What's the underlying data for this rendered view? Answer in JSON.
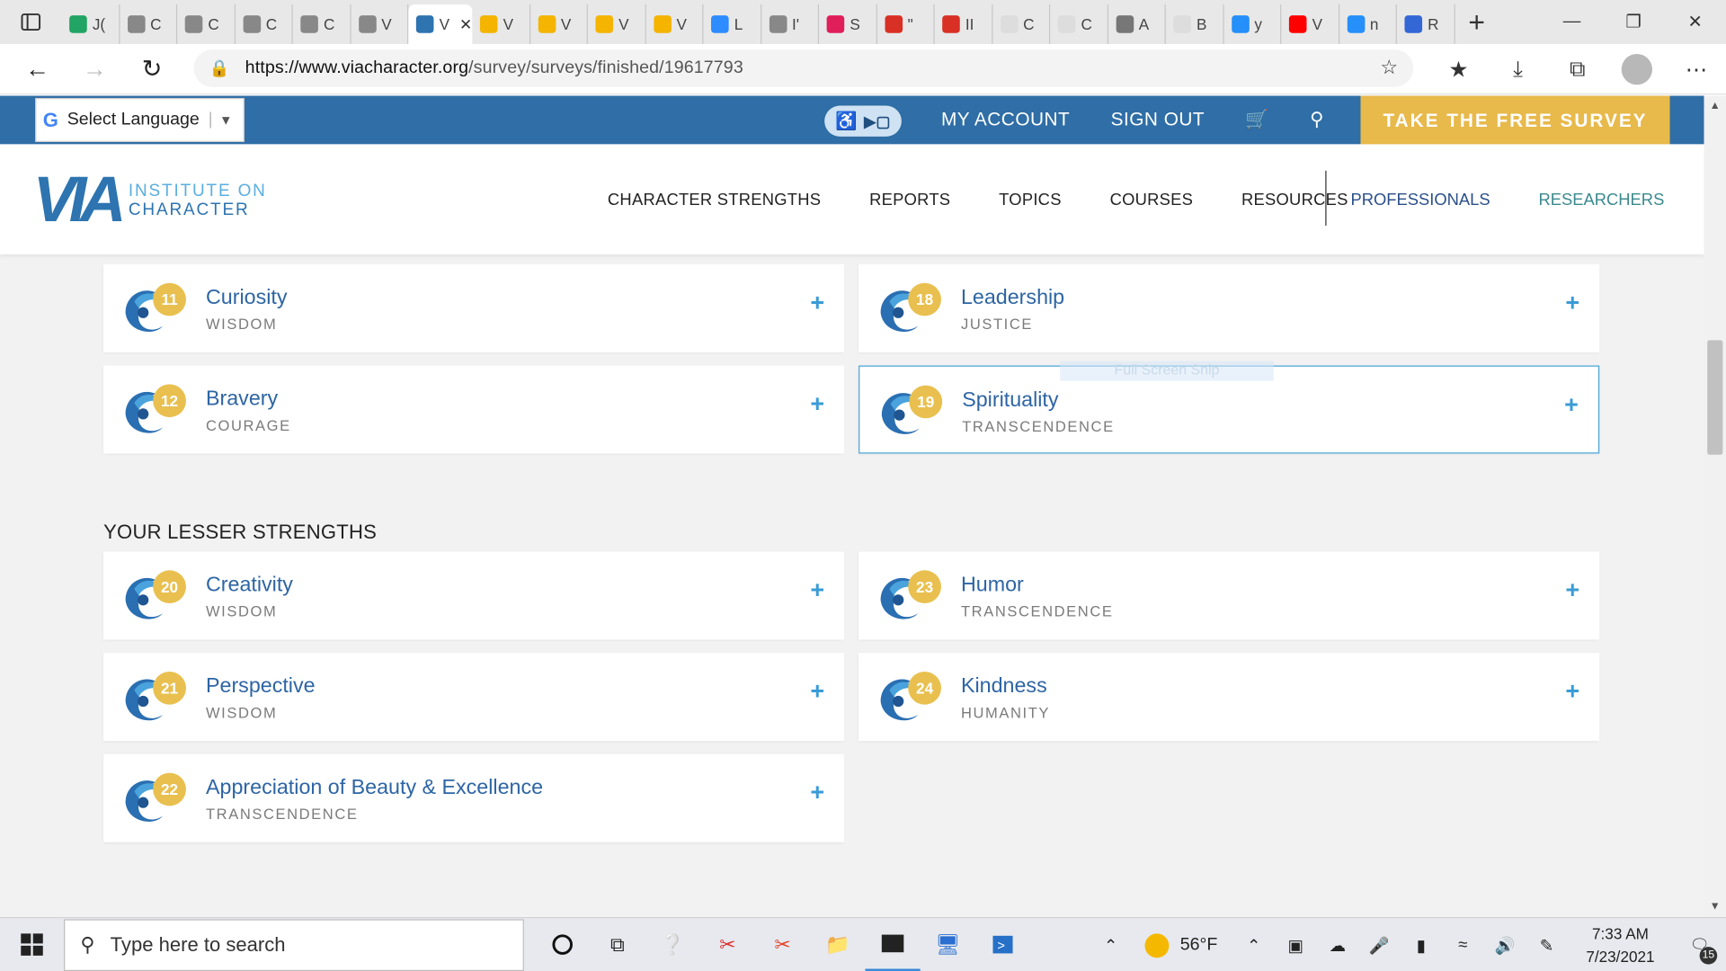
{
  "browser": {
    "tabs": [
      {
        "icon": "sheets-icon",
        "title": "J(",
        "color": "#21a464"
      },
      {
        "icon": "arrow-page-icon",
        "title": "C",
        "color": "#888"
      },
      {
        "icon": "arrow-page-icon",
        "title": "C",
        "color": "#888"
      },
      {
        "icon": "arrow-page-icon",
        "title": "C",
        "color": "#888"
      },
      {
        "icon": "arrow-page-icon",
        "title": "C",
        "color": "#888"
      },
      {
        "icon": "arrow-page-icon",
        "title": "V",
        "color": "#888"
      },
      {
        "icon": "via-icon",
        "title": "V",
        "color": "#2d74b0",
        "active": true
      },
      {
        "icon": "slides-icon",
        "title": "V",
        "color": "#f4b400"
      },
      {
        "icon": "slides-icon",
        "title": "V",
        "color": "#f4b400"
      },
      {
        "icon": "slides-icon",
        "title": "V",
        "color": "#f4b400"
      },
      {
        "icon": "slides-icon",
        "title": "V",
        "color": "#f4b400"
      },
      {
        "icon": "zoom-icon",
        "title": "L",
        "color": "#2d8cff"
      },
      {
        "icon": "arrow-page-icon",
        "title": "I'",
        "color": "#888"
      },
      {
        "icon": "slack-icon",
        "title": "S",
        "color": "#e01e5a"
      },
      {
        "icon": "gmail-icon",
        "title": "\"",
        "color": "#d93025"
      },
      {
        "icon": "gmail-icon",
        "title": "II",
        "color": "#d93025"
      },
      {
        "icon": "cloud-icon",
        "title": "C",
        "color": "#ddd"
      },
      {
        "icon": "cloud-icon",
        "title": "C",
        "color": "#ddd"
      },
      {
        "icon": "image-icon",
        "title": "A",
        "color": "#777"
      },
      {
        "icon": "cloud-icon",
        "title": "B",
        "color": "#ddd"
      },
      {
        "icon": "bing-icon",
        "title": "y",
        "color": "#258ffa"
      },
      {
        "icon": "youtube-icon",
        "title": "V",
        "color": "#ff0000"
      },
      {
        "icon": "bing-icon",
        "title": "n",
        "color": "#258ffa"
      },
      {
        "icon": "target-icon",
        "title": "R",
        "color": "#3367d6"
      }
    ],
    "active_tab_close": "✕",
    "new_tab": "+",
    "url_host": "https://www.viacharacter.org",
    "url_path": "/survey/surveys/finished/19617793"
  },
  "site": {
    "language_label": "Select Language",
    "top_links": [
      "MY ACCOUNT",
      "SIGN OUT"
    ],
    "cta": "TAKE THE FREE SURVEY",
    "logo_mark": "VIA",
    "logo_line1": "INSTITUTE ON",
    "logo_line2": "CHARACTER",
    "nav": [
      "CHARACTER STRENGTHS",
      "REPORTS",
      "TOPICS",
      "COURSES",
      "RESOURCES"
    ],
    "nav_professionals": "PROFESSIONALS",
    "nav_researchers": "RESEARCHERS"
  },
  "strengths_top": [
    {
      "rank": "11",
      "name": "Curiosity",
      "virtue": "WISDOM",
      "icon": "curiosity-icon"
    },
    {
      "rank": "18",
      "name": "Leadership",
      "virtue": "JUSTICE",
      "icon": "leadership-icon"
    },
    {
      "rank": "12",
      "name": "Bravery",
      "virtue": "COURAGE",
      "icon": "bravery-icon"
    },
    {
      "rank": "19",
      "name": "Spirituality",
      "virtue": "TRANSCENDENCE",
      "icon": "spirituality-icon"
    }
  ],
  "lesser_title": "YOUR LESSER STRENGTHS",
  "strengths_lesser": [
    {
      "rank": "20",
      "name": "Creativity",
      "virtue": "WISDOM",
      "icon": "creativity-icon"
    },
    {
      "rank": "23",
      "name": "Humor",
      "virtue": "TRANSCENDENCE",
      "icon": "humor-icon"
    },
    {
      "rank": "21",
      "name": "Perspective",
      "virtue": "WISDOM",
      "icon": "perspective-icon"
    },
    {
      "rank": "24",
      "name": "Kindness",
      "virtue": "HUMANITY",
      "icon": "kindness-icon"
    },
    {
      "rank": "22",
      "name": "Appreciation of Beauty & Excellence",
      "virtue": "TRANSCENDENCE",
      "icon": "beauty-icon"
    }
  ],
  "ghost_text": "Full Screen Snip",
  "taskbar": {
    "search_placeholder": "Type here to search",
    "temperature": "56°F",
    "time": "7:33 AM",
    "date": "7/23/2021",
    "notifications": "15"
  },
  "colors": {
    "brand_blue": "#2f6ea6",
    "cta_gold": "#e8b94b",
    "badge_gold": "#e9c04f",
    "link_blue": "#2d65a4"
  }
}
